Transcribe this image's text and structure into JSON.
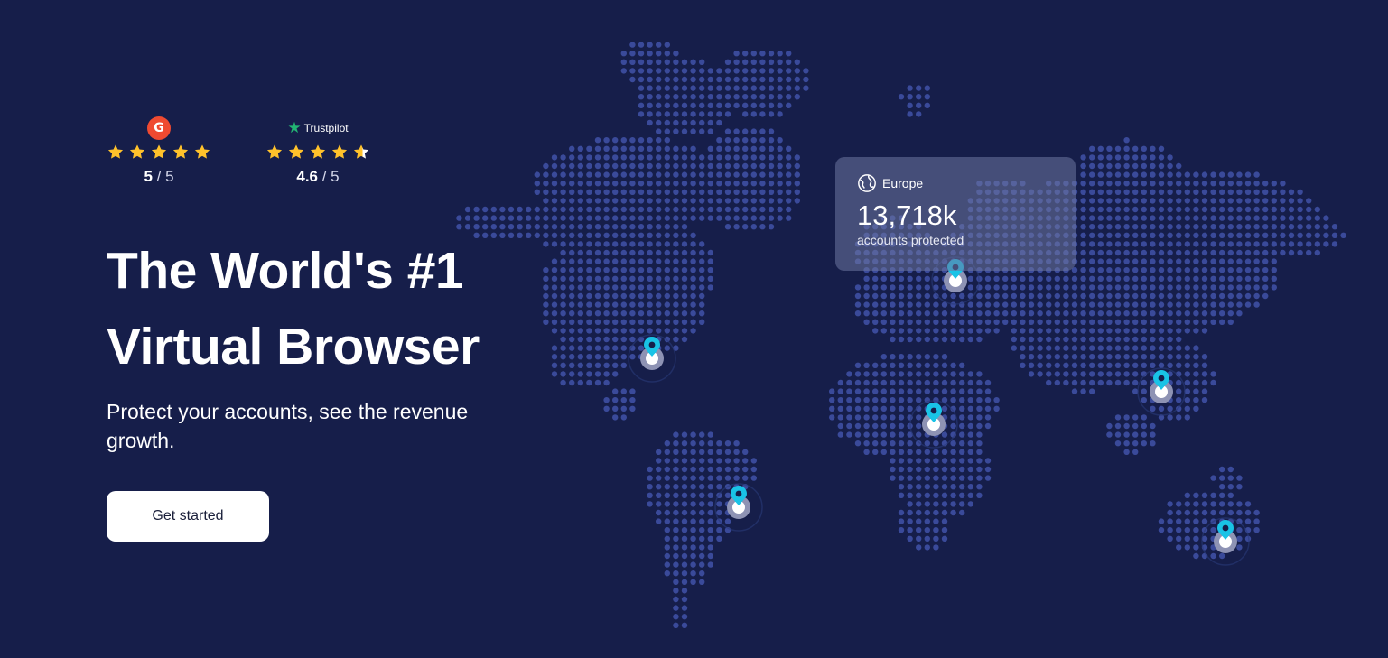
{
  "colors": {
    "background": "#161e4a",
    "map_dots": "#3a4a9a",
    "pin": "#19c3e6",
    "star": "#ffc22b",
    "g2_brand": "#ef4a31",
    "trustpilot_brand": "#22b573",
    "button_bg": "#ffffff"
  },
  "ratings": [
    {
      "brand_icon": "g2-logo-icon",
      "brand_label": "G",
      "stars": 5,
      "score": "5",
      "out_of": "/ 5"
    },
    {
      "brand_icon": "trustpilot-star-icon",
      "brand_label": "Trustpilot",
      "stars": 4.6,
      "score": "4.6",
      "out_of": "/ 5"
    }
  ],
  "hero": {
    "title_line1": "The World's #1",
    "title_line2": "Virtual Browser",
    "subtitle": "Protect your accounts, see the revenue growth.",
    "cta_label": "Get started"
  },
  "stat_card": {
    "icon": "globe-icon",
    "region": "Europe",
    "value": "13,718k",
    "caption": "accounts protected"
  },
  "map": {
    "pins": [
      {
        "name": "north-america-pin",
        "icon": "location-pin-icon"
      },
      {
        "name": "south-america-pin",
        "icon": "location-pin-icon"
      },
      {
        "name": "europe-pin",
        "icon": "location-pin-icon"
      },
      {
        "name": "africa-pin",
        "icon": "location-pin-icon"
      },
      {
        "name": "asia-pin",
        "icon": "location-pin-icon"
      },
      {
        "name": "australia-pin",
        "icon": "location-pin-icon"
      }
    ]
  }
}
